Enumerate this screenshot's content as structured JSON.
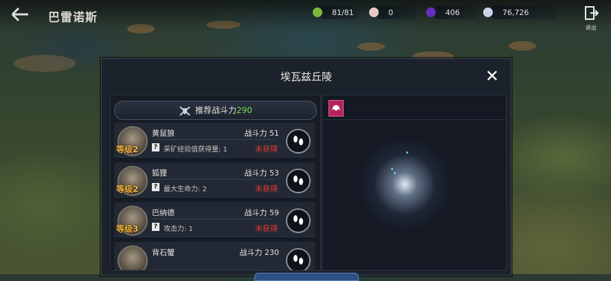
{
  "header": {
    "title": "巴雷诺斯",
    "exit_label": "退出",
    "resources": [
      {
        "icon": "stamina-icon",
        "value": "81/81",
        "color": "#7fb53a"
      },
      {
        "icon": "pearl-icon",
        "value": "0",
        "color": "#e9c9c7"
      },
      {
        "icon": "dark-crystal-icon",
        "value": "406",
        "color": "#6a2cbf"
      },
      {
        "icon": "silver-coin-icon",
        "value": "76,726",
        "color": "#c9d5e6"
      }
    ]
  },
  "modal": {
    "title": "埃瓦兹丘陵",
    "recommend_label": "推荐战斗力",
    "recommend_value": "290",
    "monsters": [
      {
        "name": "黄鼠狼",
        "power_label": "战斗力",
        "power": "51",
        "level": "等级2",
        "bonus": "采矿经验值获得量: 1",
        "status": "未获得"
      },
      {
        "name": "狐狸",
        "power_label": "战斗力",
        "power": "53",
        "level": "等级2",
        "bonus": "最大生命力: 2",
        "status": "未获得"
      },
      {
        "name": "巴纳德",
        "power_label": "战斗力",
        "power": "59",
        "level": "等级3",
        "bonus": "攻击力: 1",
        "status": "未获得"
      },
      {
        "name": "背石蟹",
        "power_label": "战斗力",
        "power": "230",
        "level": "",
        "bonus": "",
        "status": ""
      }
    ]
  },
  "colors": {
    "accent_green": "#6fdc4a",
    "status_red": "#e63a2e",
    "level_gold": "#f2b23a"
  }
}
